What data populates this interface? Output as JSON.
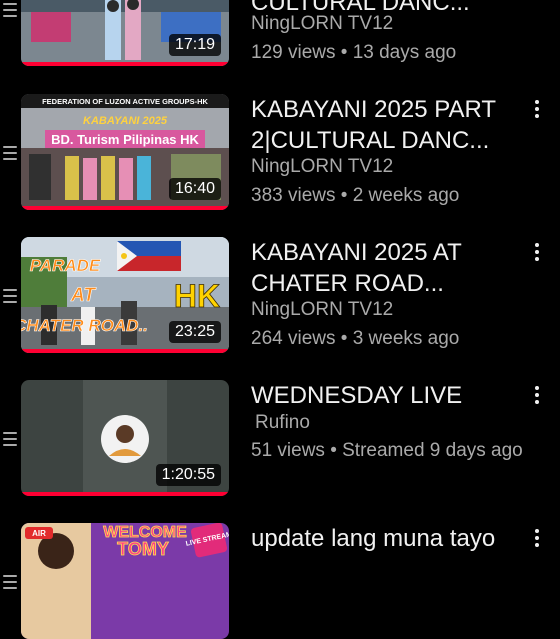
{
  "colors": {
    "background": "#000000",
    "progress": "#ff0033",
    "secondary_text": "#aaaaaa"
  },
  "videos": [
    {
      "title": "CULTURAL DANC...",
      "channel": "NingLORN TV12",
      "meta": "129 views • 13 days ago",
      "duration": "17:19",
      "progress": 1.0
    },
    {
      "title": "KABAYANI 2025 PART 2|CULTURAL DANC...",
      "channel": "NingLORN TV12",
      "meta": "383 views • 2 weeks ago",
      "duration": "16:40",
      "progress": 1.0,
      "thumb_texts": [
        "FEDERATION OF LUZON ACTIVE GROUPS-HK",
        "KABAYANI 2025",
        "BD. Turism Pilipinas HK"
      ]
    },
    {
      "title": "KABAYANI 2025 AT CHATER ROAD...",
      "channel": "NingLORN TV12",
      "meta": "264 views • 3 weeks ago",
      "duration": "23:25",
      "progress": 1.0,
      "thumb_texts": [
        "PARADE",
        "AT",
        "CHATER ROAD..",
        "HK"
      ]
    },
    {
      "title": "WEDNESDAY LIVE",
      "channel": "Rufino",
      "meta": "51 views • Streamed 9 days ago",
      "duration": "1:20:55",
      "progress": 1.0
    },
    {
      "title": "update lang muna tayo",
      "channel": "",
      "meta": "",
      "duration": "",
      "progress": 0,
      "thumb_texts": [
        "AIR",
        "WELCOME",
        "TOMY",
        "LIVE STREAM"
      ]
    }
  ]
}
